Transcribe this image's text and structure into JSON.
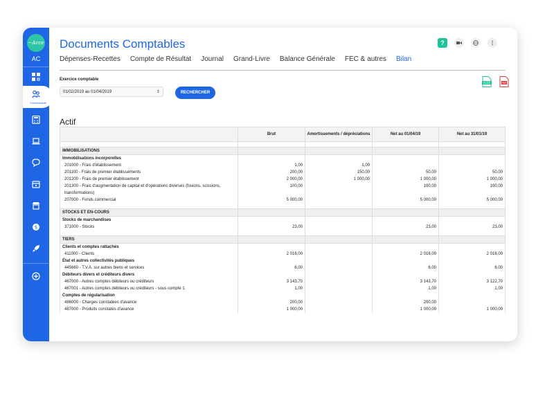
{
  "app": {
    "logo_text": "~Acce",
    "user_initials": "AC",
    "active_nav_label": "Communauté",
    "title": "Documents Comptables",
    "help_label": "?"
  },
  "tabs": [
    {
      "label": "Dépenses-Recettes",
      "active": false
    },
    {
      "label": "Compte de Résultat",
      "active": false
    },
    {
      "label": "Journal",
      "active": false
    },
    {
      "label": "Grand-Livre",
      "active": false
    },
    {
      "label": "Balance Générale",
      "active": false
    },
    {
      "label": "FEC & autres",
      "active": false
    },
    {
      "label": "Bilan",
      "active": true
    }
  ],
  "filter": {
    "label": "Exercice comptable",
    "selected": "01/02/2019 au 01/04/2019",
    "search_button": "RECHERCHER"
  },
  "export": {
    "xlsx_label": "XLSX",
    "pdf_label": "PDF"
  },
  "section_title": "Actif",
  "table": {
    "headers": [
      "",
      "Brut",
      "Amortissements / dépréciations",
      "Net au 01/04/19",
      "Net au 31/01/19"
    ],
    "rows": [
      {
        "type": "blank",
        "cells": [
          "",
          "",
          "",
          "",
          ""
        ]
      },
      {
        "type": "section",
        "cells": [
          "IMMOBILISATIONS",
          "",
          "",
          "",
          ""
        ]
      },
      {
        "type": "sub",
        "cells": [
          "Immobilisations incorporelles",
          "",
          "",
          "",
          ""
        ]
      },
      {
        "type": "item",
        "cells": [
          "201000 - Frais d'établissement",
          "1,00",
          "1,00",
          "",
          ""
        ]
      },
      {
        "type": "item",
        "cells": [
          "201100 - Frais de premier établissements",
          "200,00",
          "150,00",
          "50,00",
          "50,00"
        ]
      },
      {
        "type": "item",
        "cells": [
          "201200 - Frais de premier établissement",
          "2 000,00",
          "1 000,00",
          "1 000,00",
          "1 000,00"
        ]
      },
      {
        "type": "item",
        "cells": [
          "201300 - Frais d'augmentation de capital et d'opérations diverses (fusions, scissions, transformations)",
          "100,00",
          "",
          "100,00",
          "100,00"
        ]
      },
      {
        "type": "item",
        "cells": [
          "207000 - Fonds commercial",
          "5 000,00",
          "",
          "5 000,00",
          "5 000,00"
        ]
      },
      {
        "type": "blank",
        "cells": [
          "",
          "",
          "",
          "",
          ""
        ]
      },
      {
        "type": "section",
        "cells": [
          "STOCKS ET EN-COURS",
          "",
          "",
          "",
          ""
        ]
      },
      {
        "type": "sub",
        "cells": [
          "Stocks de marchandises",
          "",
          "",
          "",
          ""
        ]
      },
      {
        "type": "item",
        "cells": [
          "371000 - Stocks",
          "23,00",
          "",
          "23,00",
          "23,00"
        ]
      },
      {
        "type": "blank",
        "cells": [
          "",
          "",
          "",
          "",
          ""
        ]
      },
      {
        "type": "section",
        "cells": [
          "TIERS",
          "",
          "",
          "",
          ""
        ]
      },
      {
        "type": "sub",
        "cells": [
          "Clients et comptes rattachés",
          "",
          "",
          "",
          ""
        ]
      },
      {
        "type": "item",
        "cells": [
          "411000 - Clients",
          "2 016,00",
          "",
          "2 016,00",
          "2 016,00"
        ]
      },
      {
        "type": "sub",
        "cells": [
          "État et autres collectivités publiques",
          "",
          "",
          "",
          ""
        ]
      },
      {
        "type": "item",
        "cells": [
          "445660 - T.V.A. sur autres biens et services",
          "6,00",
          "",
          "6,00",
          "6,00"
        ]
      },
      {
        "type": "sub",
        "cells": [
          "Débiteurs divers et créditeurs divers",
          "",
          "",
          "",
          ""
        ]
      },
      {
        "type": "item",
        "cells": [
          "467000 - Autres comptes débiteurs ou créditeurs",
          "3 143,70",
          "",
          "3 143,70",
          "3 122,70"
        ]
      },
      {
        "type": "item",
        "cells": [
          "467001 - Autres comptes débiteurs ou créditeurs - sous compte 1",
          "1,00",
          "",
          "1,00",
          "1,00"
        ]
      },
      {
        "type": "sub",
        "cells": [
          "Comptes de régularisation",
          "",
          "",
          "",
          ""
        ]
      },
      {
        "type": "item",
        "cells": [
          "486000 - Charges constatées d'avance",
          "200,00",
          "",
          "200,00",
          ""
        ]
      },
      {
        "type": "item",
        "cells": [
          "487000 - Produits constatés d'avance",
          "1 000,00",
          "",
          "1 000,00",
          "1 000,00"
        ]
      }
    ]
  },
  "colors": {
    "primary": "#1f66e5",
    "accent": "#1fc39b",
    "pdf": "#e53935"
  }
}
